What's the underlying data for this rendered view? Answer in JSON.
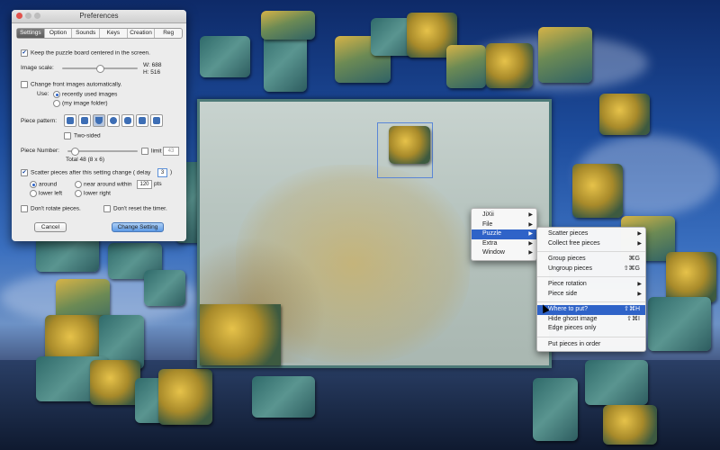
{
  "prefs": {
    "title": "Preferences",
    "tabs": [
      "Settings",
      "Option",
      "Sounds",
      "Keys",
      "Creation",
      "Reg"
    ],
    "selected_tab": "Settings",
    "keep_centered": "Keep the puzzle board centered in the screen.",
    "image_scale_label": "Image scale:",
    "image_w": "W: 688",
    "image_h": "H: 516",
    "change_front": "Change front images automatically.",
    "use_label": "Use:",
    "use_recent": "recently used images",
    "use_folder": "(my image folder)",
    "piece_pattern_label": "Piece pattern:",
    "two_sided": "Two-sided",
    "piece_number_label": "Piece Number:",
    "limit_label": "limit",
    "limit_value": "43",
    "total": "Total 48 (8 x 6)",
    "scatter_label": "Scatter pieces after this setting change",
    "delay_open": "( delay",
    "delay_value": "3",
    "delay_close": ")",
    "around": "around",
    "near_around": "near around",
    "within": "within",
    "within_value": "120",
    "pts": "pts",
    "lower_left": "lower left",
    "lower_right": "lower right",
    "dont_rotate": "Don't rotate pieces.",
    "dont_reset": "Don't reset the timer.",
    "cancel": "Cancel",
    "change_setting": "Change Setting"
  },
  "main_menu": {
    "items": [
      "JiXii",
      "File",
      "Puzzle",
      "Extra",
      "Window"
    ],
    "highlighted": "Puzzle"
  },
  "submenu": {
    "scatter": "Scatter pieces",
    "collect": "Collect free pieces",
    "group": "Group pieces",
    "group_sc": "⌘G",
    "ungroup": "Ungroup pieces",
    "ungroup_sc": "⇧⌘G",
    "rotation": "Piece rotation",
    "side": "Piece side",
    "where": "Where to put?",
    "where_sc": "⇧⌘H",
    "ghost": "Hide ghost image",
    "ghost_sc": "⇧⌘I",
    "edge": "Edge pieces only",
    "order": "Put pieces in order"
  },
  "colors": {
    "accent": "#2f63c8",
    "board_frame": "#4d7a78"
  }
}
